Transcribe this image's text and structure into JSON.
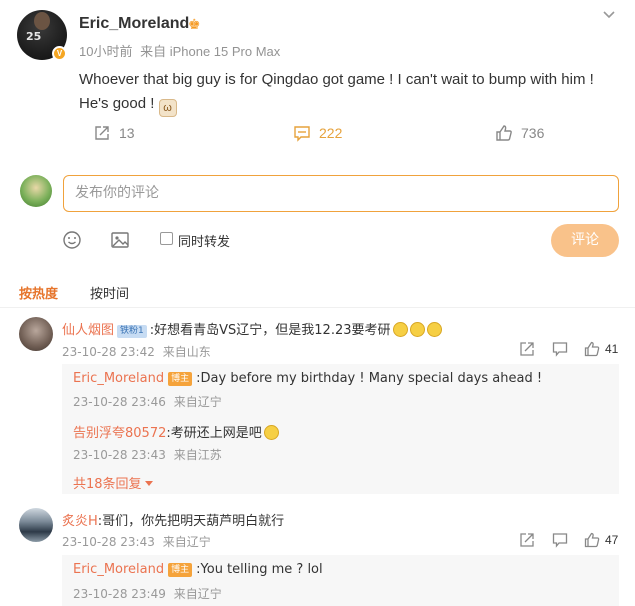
{
  "post": {
    "author": "Eric_Moreland",
    "time": "10小时前",
    "source": "来自 iPhone 15 Pro Max",
    "text": "Whoever that big guy is for Qingdao got game ! I can't wait to bump with him ! He's good !",
    "repost_count": "13",
    "comment_count": "222",
    "like_count": "736"
  },
  "composer": {
    "placeholder": "发布你的评论",
    "repost_label": "同时转发",
    "submit_label": "评论"
  },
  "sort": {
    "hot": "按热度",
    "time": "按时间"
  },
  "comments": [
    {
      "user": "仙人烟图",
      "badge": "铁粉1",
      "text": ":好想看青岛VS辽宁，但是我12.23要考研",
      "time": "23-10-28 23:42",
      "location": "来自山东",
      "likes": "41",
      "replies": [
        {
          "user": "Eric_Moreland",
          "badge": "博主",
          "text": ":Day before my birthday ! Many special days ahead !",
          "time": "23-10-28 23:46",
          "location": "来自辽宁"
        },
        {
          "user": "告别浮夸80572",
          "text": ":考研还上网是吧",
          "time": "23-10-28 23:43",
          "location": "来自江苏"
        }
      ],
      "more": "共18条回复"
    },
    {
      "user": "炙炎H",
      "text": ":哥们，你先把明天葫芦明白就行",
      "time": "23-10-28 23:43",
      "location": "来自辽宁",
      "likes": "47",
      "replies": [
        {
          "user": "Eric_Moreland",
          "badge": "博主",
          "text": ":You telling me ? lol",
          "time": "23-10-28 23:49",
          "location": "来自辽宁"
        }
      ]
    }
  ],
  "colors": {
    "accent": "#eb7350",
    "orange": "#f5a623",
    "submit_bg": "#f9c28a"
  }
}
